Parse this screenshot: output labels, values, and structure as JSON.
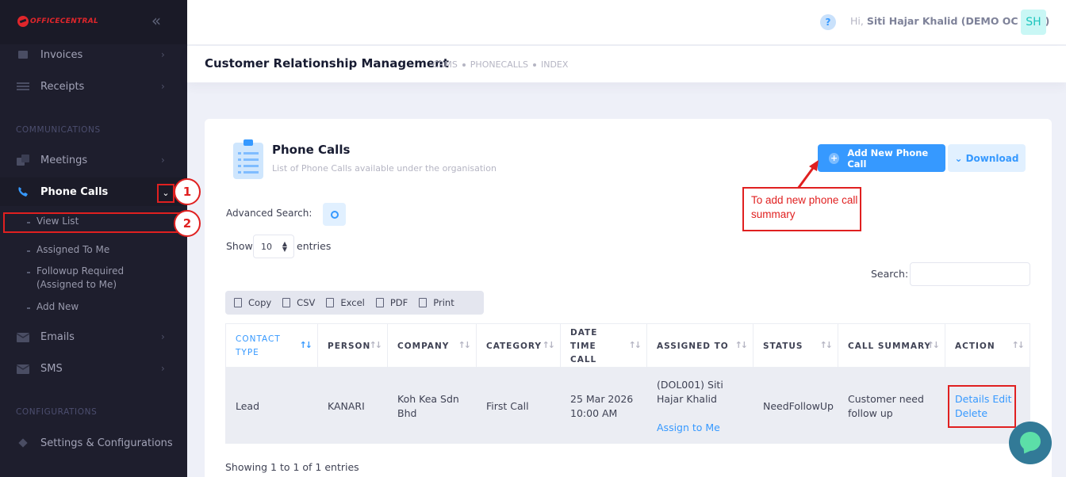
{
  "brand": {
    "logo_text": "OFFICECENTRAL"
  },
  "sidebar": {
    "items": [
      {
        "label": "Invoices",
        "icon": "invoice-icon"
      },
      {
        "label": "Receipts",
        "icon": "receipt-icon"
      },
      {
        "label": "Meetings",
        "icon": "meeting-icon"
      },
      {
        "label": "Phone Calls",
        "icon": "phone-icon"
      },
      {
        "label": "Emails",
        "icon": "email-icon"
      },
      {
        "label": "SMS",
        "icon": "sms-icon"
      },
      {
        "label": "Settings & Configurations",
        "icon": "settings-icon"
      }
    ],
    "sections": {
      "communications": "COMMUNICATIONS",
      "configurations": "CONFIGURATIONS"
    },
    "phone_calls_sub": [
      "View List",
      "Assigned To Me",
      "Followup Required (Assigned to Me)",
      "Add New"
    ]
  },
  "annotations": {
    "step1": "1",
    "step2": "2",
    "callout": "To add new phone call summary"
  },
  "header": {
    "greeting_prefix": "Hi, ",
    "user_name": "Siti Hajar Khalid (DEMO OC LITE)",
    "avatar_initials": "SH",
    "help": "?"
  },
  "subheader": {
    "title": "Customer Relationship Management",
    "breadcrumbs": [
      "CRMS",
      "PHONECALLS",
      "INDEX"
    ]
  },
  "card": {
    "title": "Phone Calls",
    "subtitle": "List of Phone Calls available under the organisation",
    "add_button": "Add New Phone Call",
    "download_button": "Download",
    "advanced_search_label": "Advanced Search:",
    "show_label": "Show",
    "entries_value": "10",
    "entries_label": "entries",
    "search_label": "Search:",
    "export_buttons": [
      "Copy",
      "CSV",
      "Excel",
      "PDF",
      "Print"
    ],
    "columns": [
      "CONTACT TYPE",
      "PERSON",
      "COMPANY",
      "CATEGORY",
      "DATE TIME CALL",
      "ASSIGNED TO",
      "STATUS",
      "CALL SUMMARY",
      "ACTION"
    ],
    "rows": [
      {
        "contact_type": "Lead",
        "person": "KANARI",
        "company": "Koh Kea Sdn Bhd",
        "category": "First Call",
        "date_time": "25 Mar 2026 10:00 AM",
        "assigned_to": "(DOL001) Siti Hajar Khalid",
        "assign_link": "Assign to Me",
        "status": "NeedFollowUp",
        "call_summary": "Customer need follow up",
        "action_details": "Details",
        "action_edit": "Edit",
        "action_delete": "Delete"
      }
    ],
    "footer": "Showing 1 to 1 of 1 entries"
  },
  "colors": {
    "accent": "#3699ff",
    "sidebar": "#1e1e2d",
    "annotation": "#e02020"
  }
}
